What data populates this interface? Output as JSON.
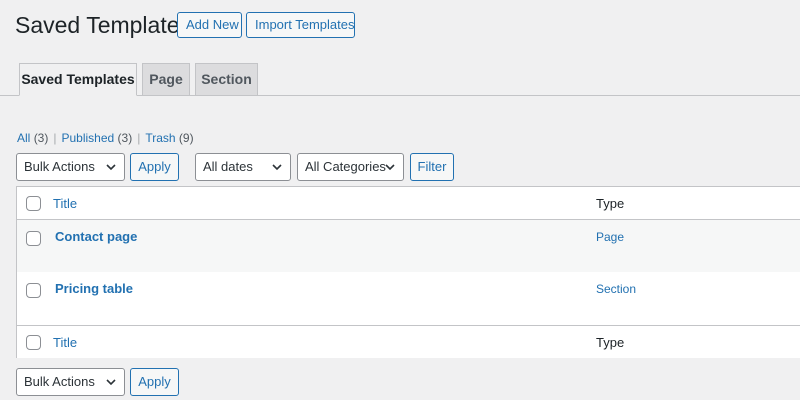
{
  "header": {
    "title": "Saved Templates",
    "add_new_label": "Add New",
    "import_label": "Import Templates"
  },
  "tabs": [
    {
      "label": "Saved Templates",
      "active": true
    },
    {
      "label": "Page",
      "active": false
    },
    {
      "label": "Section",
      "active": false
    }
  ],
  "filters": {
    "all_label": "All",
    "all_count": "(3)",
    "published_label": "Published",
    "published_count": "(3)",
    "trash_label": "Trash",
    "trash_count": "(9)",
    "separator": "|"
  },
  "toolbar_top": {
    "bulk_actions": "Bulk Actions",
    "apply_label": "Apply",
    "dates": "All dates",
    "categories": "All Categories",
    "filter_label": "Filter"
  },
  "table": {
    "columns": {
      "title": "Title",
      "type": "Type"
    },
    "rows": [
      {
        "title": "Contact page",
        "type": "Page"
      },
      {
        "title": "Pricing table",
        "type": "Section"
      }
    ]
  },
  "toolbar_bottom": {
    "bulk_actions": "Bulk Actions",
    "apply_label": "Apply"
  },
  "colors": {
    "accent": "#2271b1",
    "background": "#f0f0f1",
    "border": "#c3c4c7"
  }
}
